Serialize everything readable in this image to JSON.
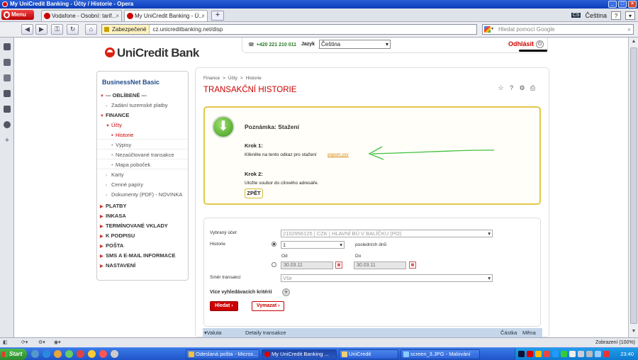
{
  "window": {
    "title": "My UniCredit Banking - Účty / Historie - Opera"
  },
  "browser": {
    "menu_label": "Menu",
    "tabs": [
      {
        "label": "Vodafone - Osobní: tarif..."
      },
      {
        "label": "My UniCredit Banking - Ú..."
      }
    ],
    "new_tab": "+",
    "language": "Čeština",
    "lang_code": "CS",
    "help_label": "?",
    "security_label": "Zabezpečené",
    "url": "cz.unicreditbanking.net/disp",
    "search_placeholder": "Hledat pomocí Google"
  },
  "page": {
    "logo": "UniCredit Bank",
    "phone": "+420 221 210 011",
    "lang_label": "Jazyk",
    "lang_value": "Čeština",
    "logout": "Odhlásit",
    "nav": {
      "title": "BusinessNet Basic",
      "items": [
        {
          "label": "--- OBLÍBENÉ ---"
        },
        {
          "label": "Zadání tuzemské platby"
        },
        {
          "label": "FINANCE"
        },
        {
          "label": "Účty"
        },
        {
          "label": "Historie"
        },
        {
          "label": "Výpisy"
        },
        {
          "label": "Nezaúčtované transakce"
        },
        {
          "label": "Mapa poboček"
        },
        {
          "label": "Karty"
        },
        {
          "label": "Cenné papíry"
        },
        {
          "label": "Dokumenty (PDF) - NOVINKA"
        },
        {
          "label": "PLATBY"
        },
        {
          "label": "INKASA"
        },
        {
          "label": "TERMÍNOVANÉ VKLADY"
        },
        {
          "label": "K PODPISU"
        },
        {
          "label": "POŠTA"
        },
        {
          "label": "SMS A E-MAIL INFORMACE"
        },
        {
          "label": "NASTAVENÍ"
        }
      ]
    },
    "breadcrumb": [
      "Finance",
      "Účty",
      "Historie"
    ],
    "breadcrumb_sep": ">",
    "title": "TRANSAKČNÍ HISTORIE",
    "note": {
      "heading": "Poznámka: Stažení",
      "step1_title": "Krok 1:",
      "step1_text": "Klikněte na tento odkaz pro stažení",
      "step1_link": "export.csv",
      "step2_title": "Krok 2:",
      "step2_text": "Uložte soubor do cílového adresáře.",
      "back": "ZPĚT"
    },
    "filters": {
      "account_label": "Vybraný účet",
      "account_value": "2102956125 | CZK | HLAVNÍ BÚ V BALÍČKU (PO)",
      "history_label": "Historie",
      "days_value": "1",
      "days_suffix": "posledních dnů",
      "from_label": "Od",
      "to_label": "Do",
      "from_date": "30.03.11",
      "to_date": "30.03.11",
      "direction_label": "Směr transakcí",
      "direction_value": "Vše",
      "more_criteria": "Více vyhledávacích kritérií",
      "search_btn": "Hledat",
      "clear_btn": "Vymazat"
    },
    "table": {
      "col_value": "Valuta",
      "col_details": "Detaily transakce",
      "col_amount": "Částka",
      "col_currency": "Měna"
    }
  },
  "statusbar": {
    "zoom": "Zobrazení (100%)"
  },
  "taskbar": {
    "start": "Start",
    "tasks": [
      {
        "label": "Odeslaná pošta - Micros..."
      },
      {
        "label": "My UniCredit Banking ..."
      },
      {
        "label": "UniCredit"
      },
      {
        "label": "screen_3.JPG - Malování"
      }
    ],
    "clock": "23:40"
  },
  "colors": {
    "brand_red": "#c00000",
    "note_border": "#e3c84b",
    "arrow_green": "#40c040",
    "taskbar_blue": "#2458d0"
  }
}
